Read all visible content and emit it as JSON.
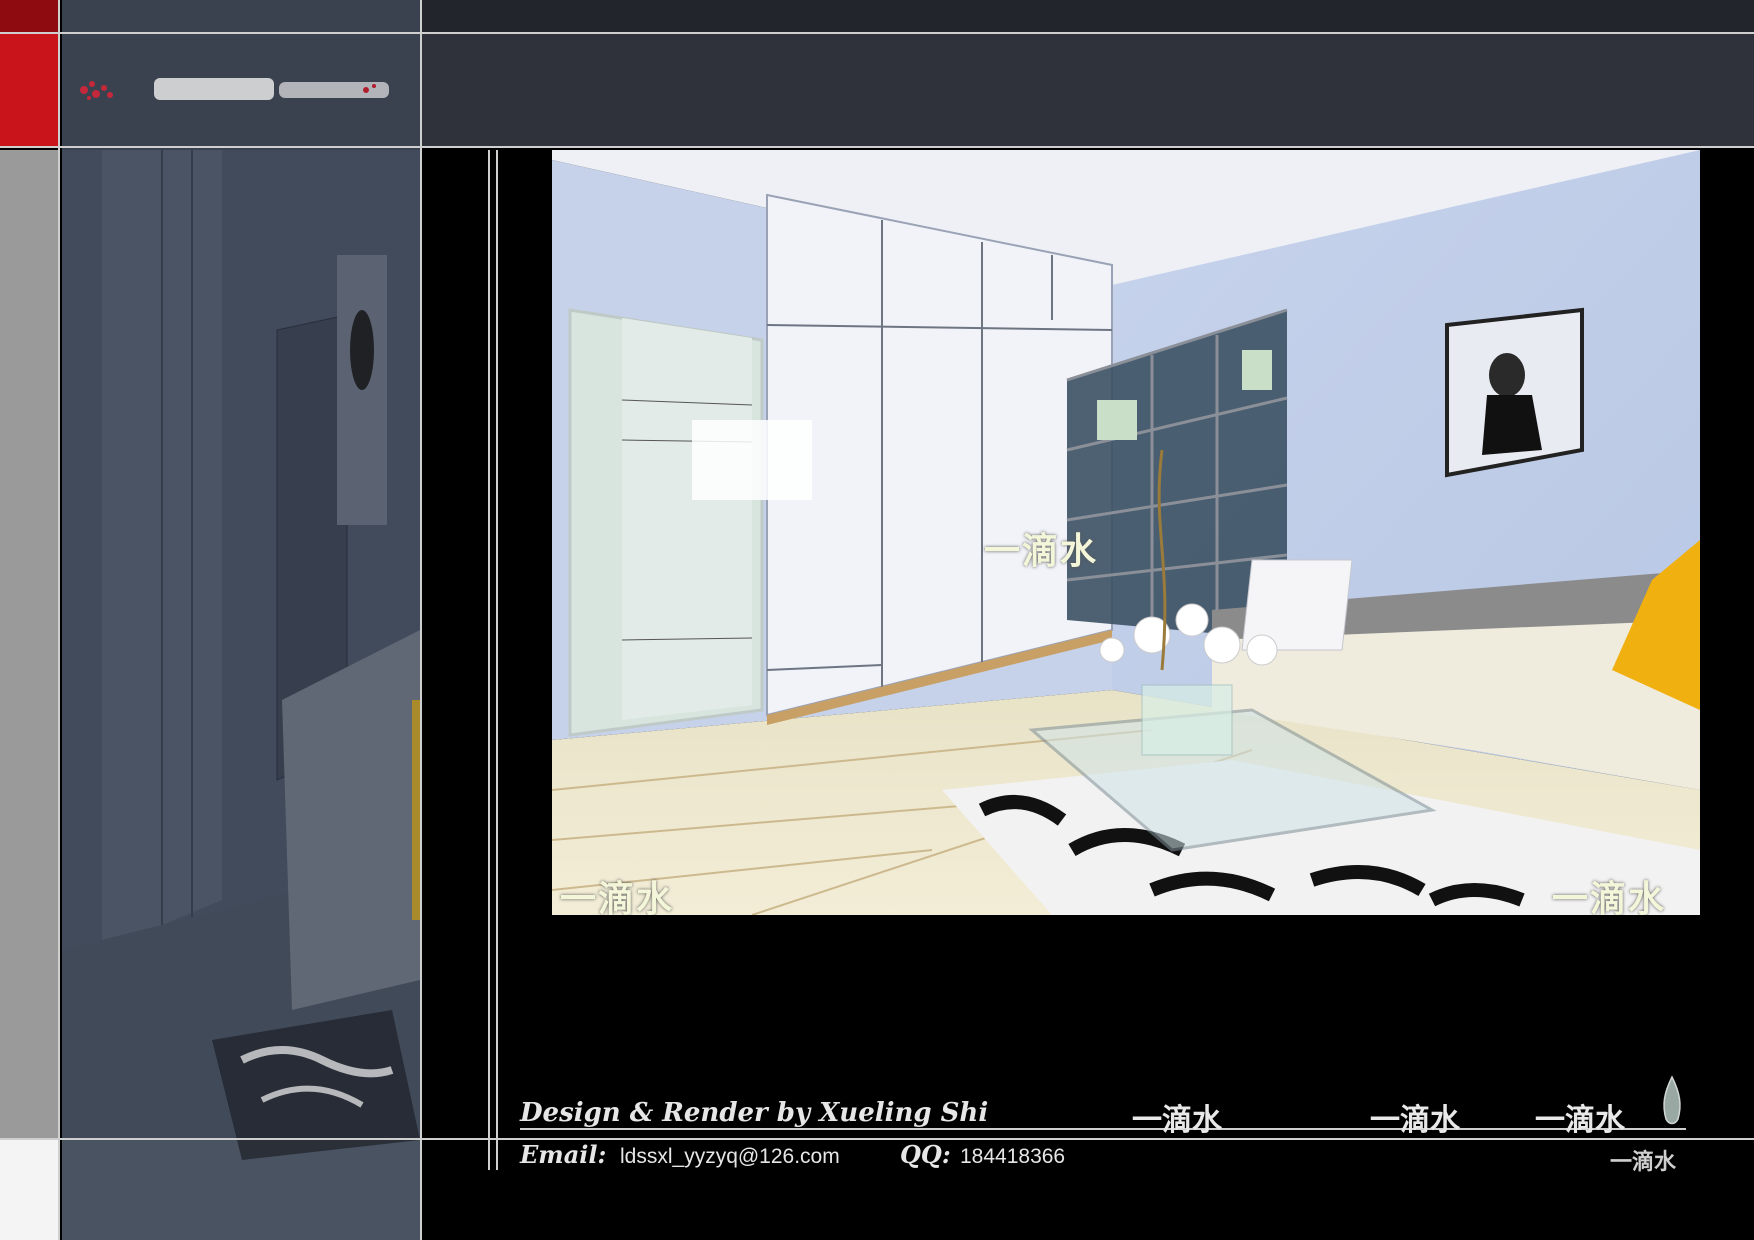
{
  "watermark": {
    "text": "一滴水"
  },
  "footer": {
    "credit": "Design & Render by Xueling Shi",
    "email_label": "Email:",
    "email": "ldssxl_yyzyq@126.com",
    "qq_label": "QQ:",
    "qq": "184418366",
    "brand_a": "一滴水",
    "brand_b": "一滴水",
    "brand_c": "一滴水",
    "brand_small": "一滴水"
  },
  "colors": {
    "frame_red": "#c8141a",
    "frame_grey": "#9a9a9b",
    "panel_dark": "#2f323a",
    "wall_blue": "#c9d6ee",
    "pillow_yellow": "#f0b010"
  },
  "icons": [
    "logo-glyph",
    "water-drop-icon"
  ]
}
